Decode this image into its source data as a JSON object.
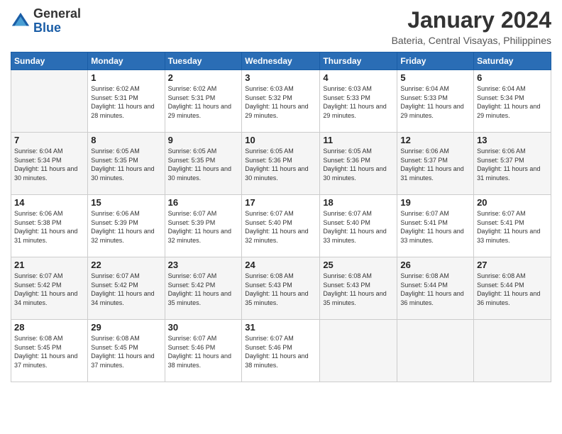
{
  "logo": {
    "general": "General",
    "blue": "Blue"
  },
  "header": {
    "month": "January 2024",
    "location": "Bateria, Central Visayas, Philippines"
  },
  "weekdays": [
    "Sunday",
    "Monday",
    "Tuesday",
    "Wednesday",
    "Thursday",
    "Friday",
    "Saturday"
  ],
  "weeks": [
    [
      {
        "day": "",
        "sunrise": "",
        "sunset": "",
        "daylight": ""
      },
      {
        "day": "1",
        "sunrise": "Sunrise: 6:02 AM",
        "sunset": "Sunset: 5:31 PM",
        "daylight": "Daylight: 11 hours and 28 minutes."
      },
      {
        "day": "2",
        "sunrise": "Sunrise: 6:02 AM",
        "sunset": "Sunset: 5:31 PM",
        "daylight": "Daylight: 11 hours and 29 minutes."
      },
      {
        "day": "3",
        "sunrise": "Sunrise: 6:03 AM",
        "sunset": "Sunset: 5:32 PM",
        "daylight": "Daylight: 11 hours and 29 minutes."
      },
      {
        "day": "4",
        "sunrise": "Sunrise: 6:03 AM",
        "sunset": "Sunset: 5:33 PM",
        "daylight": "Daylight: 11 hours and 29 minutes."
      },
      {
        "day": "5",
        "sunrise": "Sunrise: 6:04 AM",
        "sunset": "Sunset: 5:33 PM",
        "daylight": "Daylight: 11 hours and 29 minutes."
      },
      {
        "day": "6",
        "sunrise": "Sunrise: 6:04 AM",
        "sunset": "Sunset: 5:34 PM",
        "daylight": "Daylight: 11 hours and 29 minutes."
      }
    ],
    [
      {
        "day": "7",
        "sunrise": "Sunrise: 6:04 AM",
        "sunset": "Sunset: 5:34 PM",
        "daylight": "Daylight: 11 hours and 30 minutes."
      },
      {
        "day": "8",
        "sunrise": "Sunrise: 6:05 AM",
        "sunset": "Sunset: 5:35 PM",
        "daylight": "Daylight: 11 hours and 30 minutes."
      },
      {
        "day": "9",
        "sunrise": "Sunrise: 6:05 AM",
        "sunset": "Sunset: 5:35 PM",
        "daylight": "Daylight: 11 hours and 30 minutes."
      },
      {
        "day": "10",
        "sunrise": "Sunrise: 6:05 AM",
        "sunset": "Sunset: 5:36 PM",
        "daylight": "Daylight: 11 hours and 30 minutes."
      },
      {
        "day": "11",
        "sunrise": "Sunrise: 6:05 AM",
        "sunset": "Sunset: 5:36 PM",
        "daylight": "Daylight: 11 hours and 30 minutes."
      },
      {
        "day": "12",
        "sunrise": "Sunrise: 6:06 AM",
        "sunset": "Sunset: 5:37 PM",
        "daylight": "Daylight: 11 hours and 31 minutes."
      },
      {
        "day": "13",
        "sunrise": "Sunrise: 6:06 AM",
        "sunset": "Sunset: 5:37 PM",
        "daylight": "Daylight: 11 hours and 31 minutes."
      }
    ],
    [
      {
        "day": "14",
        "sunrise": "Sunrise: 6:06 AM",
        "sunset": "Sunset: 5:38 PM",
        "daylight": "Daylight: 11 hours and 31 minutes."
      },
      {
        "day": "15",
        "sunrise": "Sunrise: 6:06 AM",
        "sunset": "Sunset: 5:39 PM",
        "daylight": "Daylight: 11 hours and 32 minutes."
      },
      {
        "day": "16",
        "sunrise": "Sunrise: 6:07 AM",
        "sunset": "Sunset: 5:39 PM",
        "daylight": "Daylight: 11 hours and 32 minutes."
      },
      {
        "day": "17",
        "sunrise": "Sunrise: 6:07 AM",
        "sunset": "Sunset: 5:40 PM",
        "daylight": "Daylight: 11 hours and 32 minutes."
      },
      {
        "day": "18",
        "sunrise": "Sunrise: 6:07 AM",
        "sunset": "Sunset: 5:40 PM",
        "daylight": "Daylight: 11 hours and 33 minutes."
      },
      {
        "day": "19",
        "sunrise": "Sunrise: 6:07 AM",
        "sunset": "Sunset: 5:41 PM",
        "daylight": "Daylight: 11 hours and 33 minutes."
      },
      {
        "day": "20",
        "sunrise": "Sunrise: 6:07 AM",
        "sunset": "Sunset: 5:41 PM",
        "daylight": "Daylight: 11 hours and 33 minutes."
      }
    ],
    [
      {
        "day": "21",
        "sunrise": "Sunrise: 6:07 AM",
        "sunset": "Sunset: 5:42 PM",
        "daylight": "Daylight: 11 hours and 34 minutes."
      },
      {
        "day": "22",
        "sunrise": "Sunrise: 6:07 AM",
        "sunset": "Sunset: 5:42 PM",
        "daylight": "Daylight: 11 hours and 34 minutes."
      },
      {
        "day": "23",
        "sunrise": "Sunrise: 6:07 AM",
        "sunset": "Sunset: 5:42 PM",
        "daylight": "Daylight: 11 hours and 35 minutes."
      },
      {
        "day": "24",
        "sunrise": "Sunrise: 6:08 AM",
        "sunset": "Sunset: 5:43 PM",
        "daylight": "Daylight: 11 hours and 35 minutes."
      },
      {
        "day": "25",
        "sunrise": "Sunrise: 6:08 AM",
        "sunset": "Sunset: 5:43 PM",
        "daylight": "Daylight: 11 hours and 35 minutes."
      },
      {
        "day": "26",
        "sunrise": "Sunrise: 6:08 AM",
        "sunset": "Sunset: 5:44 PM",
        "daylight": "Daylight: 11 hours and 36 minutes."
      },
      {
        "day": "27",
        "sunrise": "Sunrise: 6:08 AM",
        "sunset": "Sunset: 5:44 PM",
        "daylight": "Daylight: 11 hours and 36 minutes."
      }
    ],
    [
      {
        "day": "28",
        "sunrise": "Sunrise: 6:08 AM",
        "sunset": "Sunset: 5:45 PM",
        "daylight": "Daylight: 11 hours and 37 minutes."
      },
      {
        "day": "29",
        "sunrise": "Sunrise: 6:08 AM",
        "sunset": "Sunset: 5:45 PM",
        "daylight": "Daylight: 11 hours and 37 minutes."
      },
      {
        "day": "30",
        "sunrise": "Sunrise: 6:07 AM",
        "sunset": "Sunset: 5:46 PM",
        "daylight": "Daylight: 11 hours and 38 minutes."
      },
      {
        "day": "31",
        "sunrise": "Sunrise: 6:07 AM",
        "sunset": "Sunset: 5:46 PM",
        "daylight": "Daylight: 11 hours and 38 minutes."
      },
      {
        "day": "",
        "sunrise": "",
        "sunset": "",
        "daylight": ""
      },
      {
        "day": "",
        "sunrise": "",
        "sunset": "",
        "daylight": ""
      },
      {
        "day": "",
        "sunrise": "",
        "sunset": "",
        "daylight": ""
      }
    ]
  ]
}
